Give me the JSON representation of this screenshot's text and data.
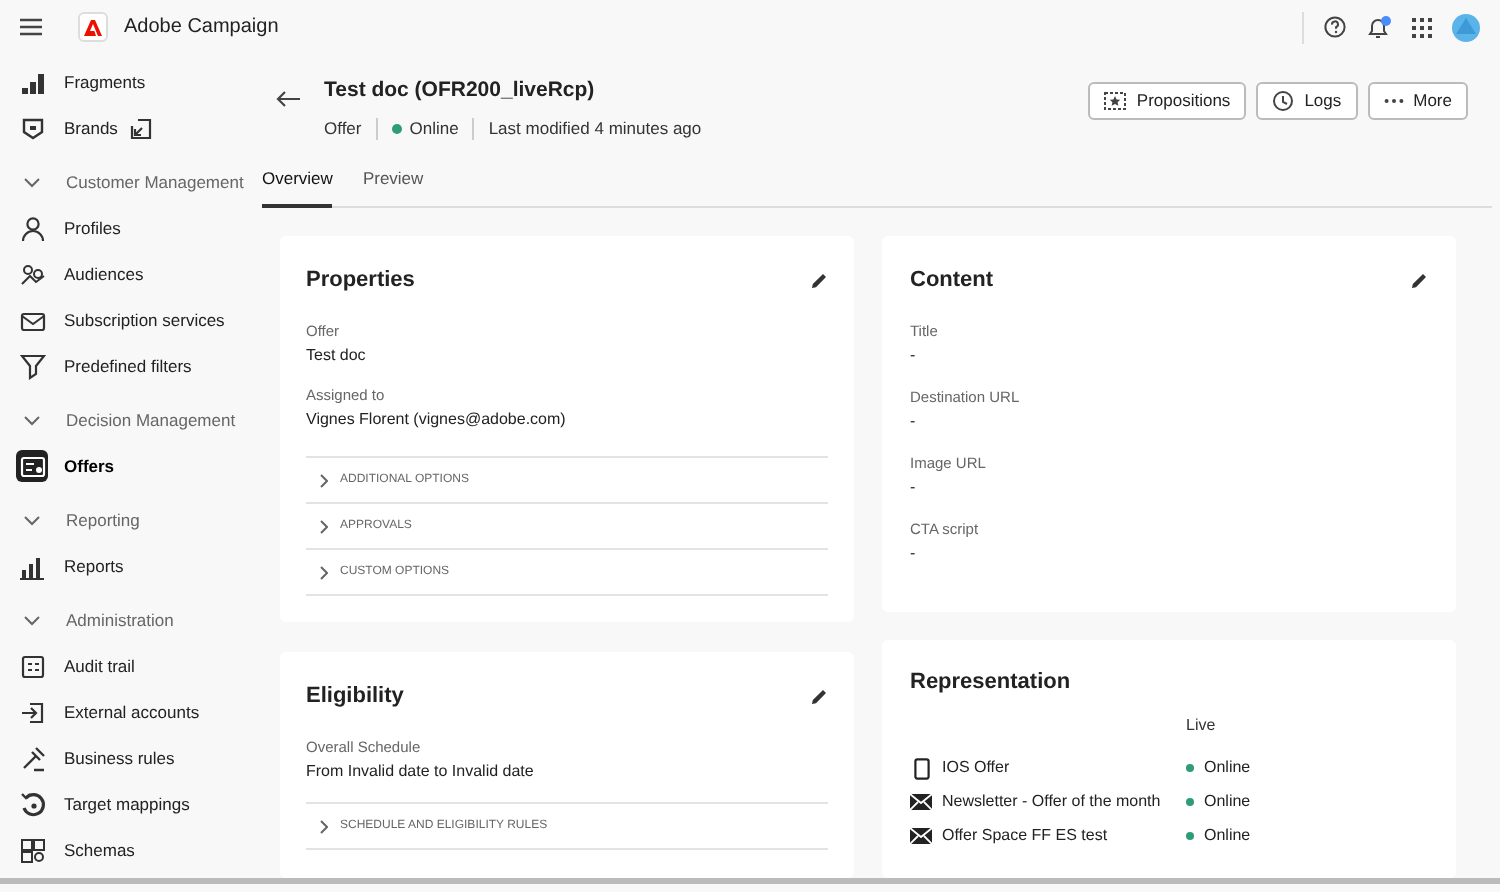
{
  "app": {
    "name": "Adobe Campaign"
  },
  "sidebar": {
    "items": [
      {
        "kind": "item",
        "label": "Fragments",
        "selected": false,
        "external": false
      },
      {
        "kind": "item",
        "label": "Brands",
        "selected": false,
        "external": true
      },
      {
        "kind": "section",
        "label": "Customer Management",
        "expanded": true
      },
      {
        "kind": "item",
        "label": "Profiles",
        "selected": false,
        "external": false
      },
      {
        "kind": "item",
        "label": "Audiences",
        "selected": false,
        "external": false
      },
      {
        "kind": "item",
        "label": "Subscription services",
        "selected": false,
        "external": false
      },
      {
        "kind": "item",
        "label": "Predefined filters",
        "selected": false,
        "external": false
      },
      {
        "kind": "section",
        "label": "Decision Management",
        "expanded": true
      },
      {
        "kind": "item",
        "label": "Offers",
        "selected": true,
        "external": false
      },
      {
        "kind": "section",
        "label": "Reporting",
        "expanded": true
      },
      {
        "kind": "item",
        "label": "Reports",
        "selected": false,
        "external": false
      },
      {
        "kind": "section",
        "label": "Administration",
        "expanded": true
      },
      {
        "kind": "item",
        "label": "Audit trail",
        "selected": false,
        "external": false
      },
      {
        "kind": "item",
        "label": "External accounts",
        "selected": false,
        "external": false
      },
      {
        "kind": "item",
        "label": "Business rules",
        "selected": false,
        "external": false
      },
      {
        "kind": "item",
        "label": "Target mappings",
        "selected": false,
        "external": false
      },
      {
        "kind": "item",
        "label": "Schemas",
        "selected": false,
        "external": false
      }
    ]
  },
  "header": {
    "notifications_unread": true
  },
  "page": {
    "title": "Test doc (OFR200_liveRcp)",
    "type": "Offer",
    "status": "Online",
    "online": true,
    "modified": "Last modified 4 minutes ago",
    "actions": [
      {
        "kind": "propositions",
        "label": "Propositions"
      },
      {
        "kind": "logs",
        "label": "Logs"
      },
      {
        "kind": "more",
        "label": "More"
      }
    ]
  },
  "tabs": [
    {
      "label": "Overview",
      "selected": true
    },
    {
      "label": "Preview",
      "selected": false
    }
  ],
  "properties": {
    "title": "Properties",
    "fields": [
      {
        "label": "Offer",
        "value": "Test doc"
      },
      {
        "label": "Assigned to",
        "value": "Vignes Florent (vignes@adobe.com)"
      }
    ],
    "sections": [
      "ADDITIONAL OPTIONS",
      "APPROVALS",
      "CUSTOM OPTIONS"
    ]
  },
  "content": {
    "title": "Content",
    "fields": [
      {
        "label": "Title",
        "value": "-"
      },
      {
        "label": "Destination URL",
        "value": "-"
      },
      {
        "label": "Image URL",
        "value": "-"
      },
      {
        "label": "CTA script",
        "value": "-"
      }
    ]
  },
  "eligibility": {
    "title": "Eligibility",
    "fields": [
      {
        "label": "Overall Schedule",
        "value": "From Invalid date to Invalid date"
      }
    ],
    "sections": [
      "SCHEDULE AND ELIGIBILITY RULES"
    ]
  },
  "representation": {
    "title": "Representation",
    "column": "Live",
    "rows": [
      {
        "kind": "mobile",
        "name": "IOS Offer",
        "status": "Online",
        "color": "#2d9d78"
      },
      {
        "kind": "email",
        "name": "Newsletter - Offer of the month",
        "status": "Online",
        "color": "#2d9d78"
      },
      {
        "kind": "email",
        "name": "Offer Space FF ES test",
        "status": "Online",
        "color": "#2d9d78"
      }
    ]
  }
}
